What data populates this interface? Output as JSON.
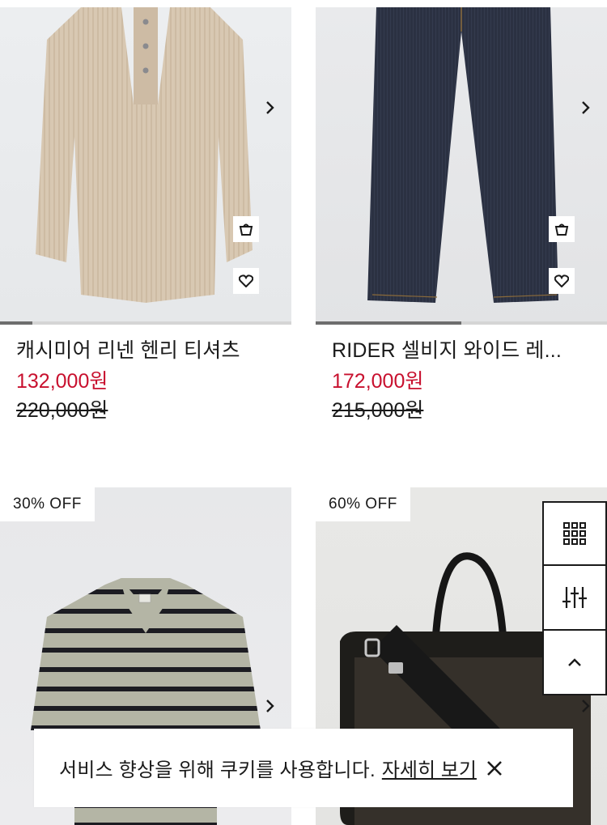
{
  "products": [
    {
      "name": "캐시미어 리넨 헨리 티셔츠",
      "sale_price": "132,000원",
      "original_price": "220,000원",
      "image_progress": 0.11
    },
    {
      "name": "RIDER 셀비지 와이드 레...",
      "sale_price": "172,000원",
      "original_price": "215,000원",
      "image_progress": 0.5
    },
    {
      "badge": "30% OFF"
    },
    {
      "badge": "60% OFF"
    }
  ],
  "icons": {
    "next": "chevron-right-icon",
    "cart": "shopping-bag-icon",
    "wishlist": "heart-icon",
    "grid": "grid-view-icon",
    "filter": "filter-sliders-icon",
    "top": "chevron-up-icon",
    "close": "close-icon"
  },
  "cookie_banner": {
    "message": "서비스 향상을 위해 쿠키를 사용합니다.",
    "link": "자세히 보기"
  },
  "colors": {
    "sale": "#c8102e",
    "text": "#1a1a1a",
    "progress_track": "#d5d5d5",
    "progress_fill": "#6d6d6d"
  }
}
